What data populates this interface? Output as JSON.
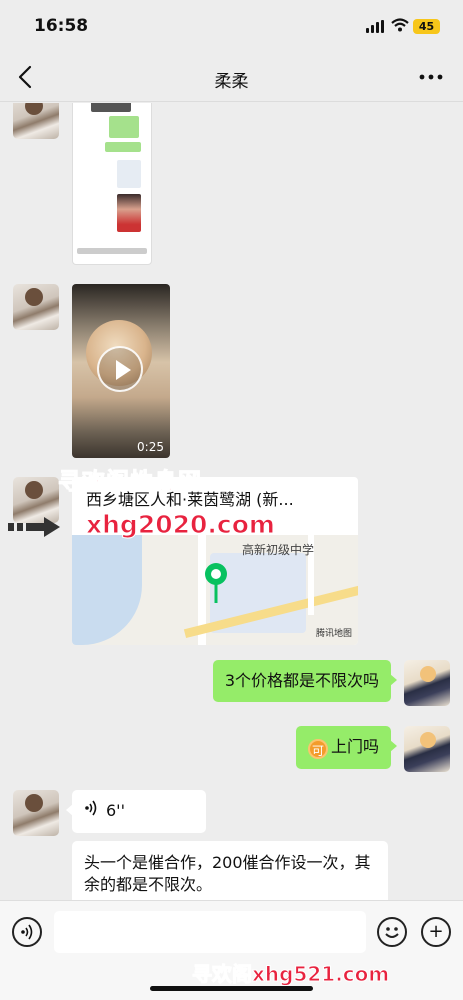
{
  "status_bar": {
    "time": "16:58",
    "battery": "45"
  },
  "nav": {
    "title": "柔柔"
  },
  "messages": {
    "video_duration": "0:25",
    "location_address": "西乡塘区人和·莱茵鹭湖 (新...",
    "location_poi": "高新初级中学",
    "map_brand": "腾讯地图",
    "sent_1": "3个价格都是不限次吗",
    "sent_2_emoji": "可",
    "sent_2_text": "上门吗",
    "voice_duration": "6''",
    "received_text": "头一个是催合作，200催合作设一次，其余的都是不限次。"
  },
  "watermark": {
    "top": "寻欢阁性息网",
    "middle": "xhg2020.com",
    "bottom": "寻欢阁xhg521.com"
  },
  "icons": {
    "back": "chevron-left-icon",
    "more": "more-dots-icon",
    "voice_input": "voice-input-icon",
    "emoji": "emoji-icon",
    "plus": "plus-icon"
  },
  "colors": {
    "sent_bubble": "#95ec69",
    "background": "#ededed",
    "watermark": "#e8233f"
  }
}
